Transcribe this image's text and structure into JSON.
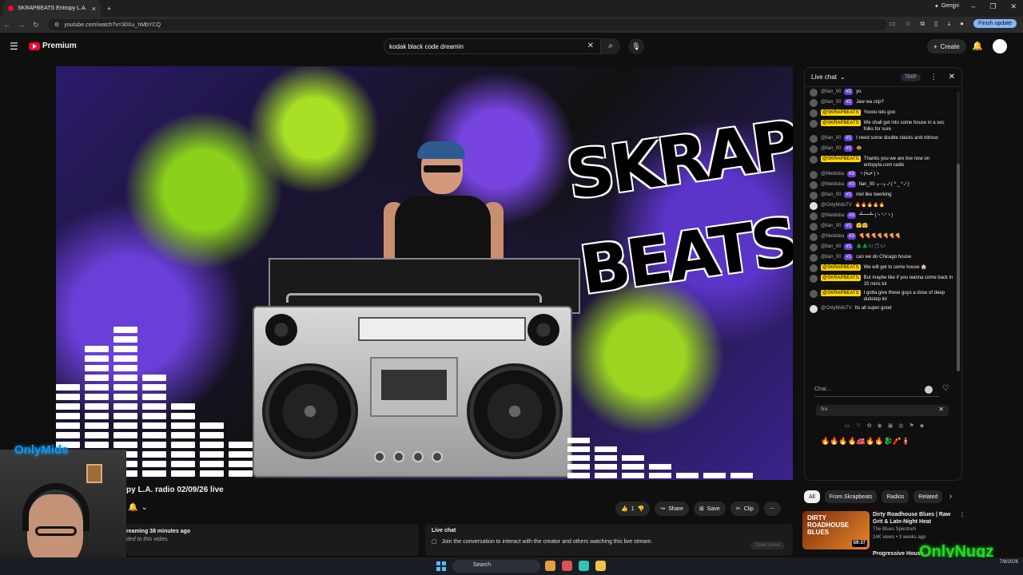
{
  "browser": {
    "tab_title": "SKRAPBEATS Entropy L.A.",
    "tab_close": "×",
    "new_tab": "+",
    "gemini": "Gemini",
    "url": "youtube.com/watch?v=30Xu_hMbYCQ",
    "finish_update": "Finish update"
  },
  "yt": {
    "brand": "Premium",
    "search_value": "kodak black code dreamin",
    "create": "Create"
  },
  "video": {
    "logo_line1": "SKRAP",
    "logo_line2": "BEATS",
    "streamer_brand": "OnlyMids",
    "watermark": "OnlyNugz"
  },
  "below": {
    "title": "py L.A. radio 02/09/26 live",
    "like_count": "1",
    "share": "Share",
    "save": "Save",
    "clip": "Clip",
    "desc_line1": "reaming 38 minutes ago",
    "desc_line2": "ded to this video.",
    "livechat_heading": "Live chat",
    "livechat_text": "Join the conversation to interact with the creator and others watching this live stream.",
    "open_panel": "Open panel"
  },
  "chat": {
    "title": "Live chat",
    "xp": "75XP",
    "input_placeholder": "Chat...",
    "emoji_search": "fire",
    "messages": [
      {
        "author": "@ilan_00",
        "badge": "#2",
        "text": "yo",
        "kind": "user"
      },
      {
        "author": "@ilan_00",
        "badge": "#2",
        "text": "Jaw wa crip?",
        "kind": "user"
      },
      {
        "author": "@SKRAPBEATS",
        "badge": "",
        "text": "Yoooo lets goo",
        "kind": "owner"
      },
      {
        "author": "@SKRAPBEATS",
        "badge": "",
        "text": "We shall get into some house in a sec folks for sure",
        "kind": "owner"
      },
      {
        "author": "@ilan_00",
        "badge": "#1",
        "text": "I need some double stacks and nitrous",
        "kind": "user"
      },
      {
        "author": "@ilan_00",
        "badge": "#1",
        "text": "🐵",
        "kind": "user"
      },
      {
        "author": "@SKRAPBEATS",
        "badge": "",
        "text": "Thanks you we are live now on entopyla.com radio",
        "kind": "owner"
      },
      {
        "author": "@Meldoba",
        "badge": "#3",
        "text": "ヽ(•̀ω•́ )ゝ",
        "kind": "user"
      },
      {
        "author": "@Meldoba",
        "badge": "#3",
        "text": "Ilan_00 ┬─┬ノ( º _ ºノ)",
        "kind": "user"
      },
      {
        "author": "@ilan_00",
        "badge": "#1",
        "text": "mel like twerking",
        "kind": "user"
      },
      {
        "author": "@OnlyMidsTV",
        "badge": "",
        "text": "🔥🔥🔥🔥🔥",
        "kind": "plain"
      },
      {
        "author": "@Meldoba",
        "badge": "#3",
        "text": "┻━┻ (ヽ°-°ヽ)",
        "kind": "user"
      },
      {
        "author": "@ilan_00",
        "badge": "#1",
        "text": "🤗🤗",
        "kind": "user"
      },
      {
        "author": "@Meldoba",
        "badge": "#3",
        "text": "🍕🍕🍕🍕🍕🍕🍕",
        "kind": "user"
      },
      {
        "author": "@ilan_00",
        "badge": "#1",
        "text": "🌲🌲🎶🎵🎶",
        "kind": "user"
      },
      {
        "author": "@ilan_00",
        "badge": "#1",
        "text": "can we do Chicago house",
        "kind": "user"
      },
      {
        "author": "@SKRAPBEATS",
        "badge": "",
        "text": "We will get to some house 🏠",
        "kind": "owner"
      },
      {
        "author": "@SKRAPBEATS",
        "badge": "",
        "text": "But maybe like if you wanna come back in 15 mins lol",
        "kind": "owner"
      },
      {
        "author": "@SKRAPBEATS",
        "badge": "",
        "text": "I gotta give these guys a dose of deep dubstep lol",
        "kind": "owner"
      },
      {
        "author": "@OnlyMidsTV",
        "badge": "",
        "text": "Its all super good",
        "kind": "plain"
      }
    ],
    "emoji_results": "🔥🔥🔥🔥🚒🔥🔥🐉🧨🧯"
  },
  "recs": {
    "chips": [
      "All",
      "From Skrapbeats",
      "Radios",
      "Related"
    ],
    "item1_thumb": "DIRTY ROADHOUSE BLUES",
    "item1_duration": "59:37",
    "item1_title": "Dirty Roadhouse Blues | Raw Grit & Late-Night Heat",
    "item1_channel": "The Blues Spectrum",
    "item1_meta": "24K views • 3 weeks ago",
    "item2_title": "Progressive House"
  },
  "taskbar": {
    "search": "Search",
    "time": "7/8/2026"
  },
  "colors": {
    "yt_red": "#ff0033",
    "owner_badge": "#ffd600",
    "member_badge": "#6b3fd8"
  }
}
